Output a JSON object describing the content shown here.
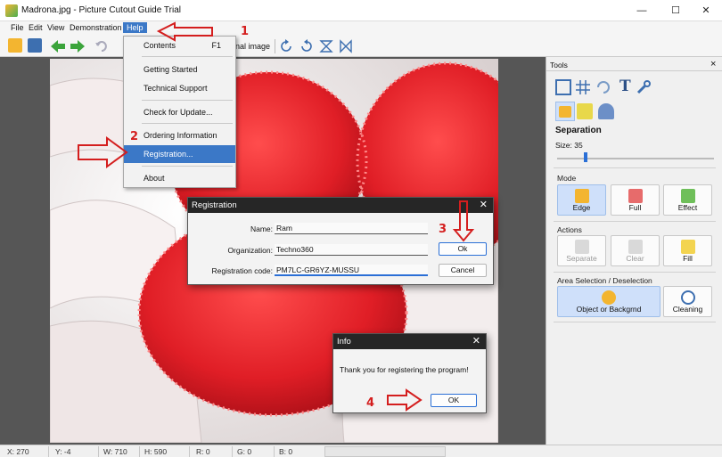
{
  "window": {
    "title": "Madrona.jpg - Picture Cutout Guide Trial",
    "controls": {
      "minimize": "—",
      "maximize": "☐",
      "close": "✕"
    }
  },
  "menubar": {
    "items": [
      {
        "label": "File"
      },
      {
        "label": "Edit"
      },
      {
        "label": "View"
      },
      {
        "label": "Demonstration"
      },
      {
        "label": "Help"
      }
    ]
  },
  "toolbar": {
    "original_image_label": "inal image"
  },
  "help_menu": {
    "contents": {
      "label": "Contents",
      "shortcut": "F1"
    },
    "getting_started": "Getting Started",
    "technical_support": "Technical Support",
    "check_update": "Check for Update...",
    "ordering_info": "Ordering Information",
    "registration": "Registration...",
    "about": "About"
  },
  "registration_dialog": {
    "title": "Registration",
    "close": "✕",
    "name_label": "Name:",
    "name_value": "Ram",
    "org_label": "Organization:",
    "org_value": "Techno360",
    "code_label": "Registration code:",
    "code_value": "PM7LC-GR6YZ-MUSSU",
    "ok": "Ok",
    "cancel": "Cancel"
  },
  "info_dialog": {
    "title": "Info",
    "close": "✕",
    "message": "Thank you for registering the program!",
    "ok": "OK"
  },
  "tools_panel": {
    "title": "Tools",
    "close": "×",
    "separation": {
      "title": "Separation",
      "size_label": "Size: 35",
      "size_fraction": 0.17
    },
    "mode": {
      "label": "Mode",
      "edge": "Edge",
      "full": "Full",
      "effect": "Effect"
    },
    "actions": {
      "label": "Actions",
      "separate": "Separate",
      "clear": "Clear",
      "fill": "Fill"
    },
    "area": {
      "label": "Area Selection / Deselection",
      "object": "Object or Backgrnd",
      "cleaning": "Cleaning"
    }
  },
  "statusbar": {
    "x": "X: 270",
    "y": "Y: -4",
    "w": "W: 710",
    "h": "H: 590",
    "r": "R: 0",
    "g": "G: 0",
    "b": "B: 0"
  },
  "annotations": {
    "step1": "1",
    "step2": "2",
    "step3": "3",
    "step4": "4"
  },
  "colors": {
    "accent": "#3b78c7",
    "annotation": "#d41e1e",
    "dialog_title": "#262626"
  }
}
